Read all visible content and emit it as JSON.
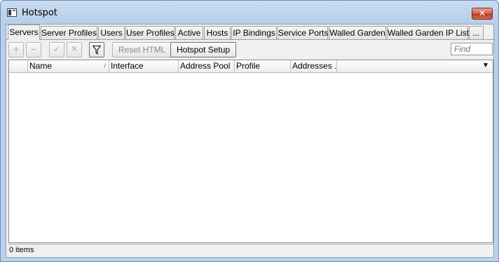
{
  "window": {
    "title": "Hotspot",
    "close_symbol": "✕",
    "icon": "window-app-icon"
  },
  "tabs": [
    {
      "label": "Servers",
      "active": true
    },
    {
      "label": "Server Profiles",
      "active": false
    },
    {
      "label": "Users",
      "active": false
    },
    {
      "label": "User Profiles",
      "active": false
    },
    {
      "label": "Active",
      "active": false
    },
    {
      "label": "Hosts",
      "active": false
    },
    {
      "label": "IP Bindings",
      "active": false
    },
    {
      "label": "Service Ports",
      "active": false
    },
    {
      "label": "Walled Garden",
      "active": false
    },
    {
      "label": "Walled Garden IP List",
      "active": false
    },
    {
      "label": "...",
      "active": false
    }
  ],
  "toolbar": {
    "add_symbol": "+",
    "remove_symbol": "−",
    "enable_symbol": "✓",
    "disable_symbol": "✕",
    "filter_icon": "filter-icon",
    "reset_html_label": "Reset HTML",
    "hotspot_setup_label": "Hotspot Setup",
    "find_placeholder": "Find"
  },
  "table": {
    "columns": [
      "",
      "Name",
      "Interface",
      "Address Pool",
      "Profile",
      "Addresses ..."
    ],
    "sort_marker": "/",
    "column_menu_symbol": "▼",
    "rows": []
  },
  "status": {
    "item_count": "0 items"
  }
}
